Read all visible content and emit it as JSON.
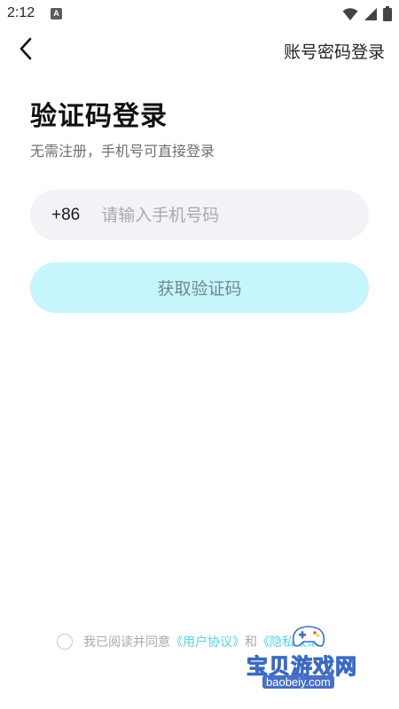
{
  "status_bar": {
    "time": "2:12",
    "notification_icon": "a-icon",
    "icons": [
      "wifi-icon",
      "signal-icon",
      "battery-icon"
    ]
  },
  "nav": {
    "back_icon": "chevron-left-icon",
    "right_link": "账号密码登录"
  },
  "page": {
    "title": "验证码登录",
    "subtitle": "无需注册，手机号可直接登录"
  },
  "phone_field": {
    "country_code": "+86",
    "value": "",
    "placeholder": "请输入手机号码"
  },
  "get_code_button": {
    "label": "获取验证码"
  },
  "agreement": {
    "checked": false,
    "prefix": "我已阅读并同意",
    "user_agreement": "《用户协议》",
    "conjunction": "和",
    "privacy_policy": "《隐私政策》"
  },
  "watermark": {
    "title": "宝贝游戏网",
    "url": "baobeiy.com"
  },
  "colors": {
    "button_bg": "#c6f6fb",
    "link": "#56d3e4",
    "field_bg": "#f2f3f6"
  }
}
